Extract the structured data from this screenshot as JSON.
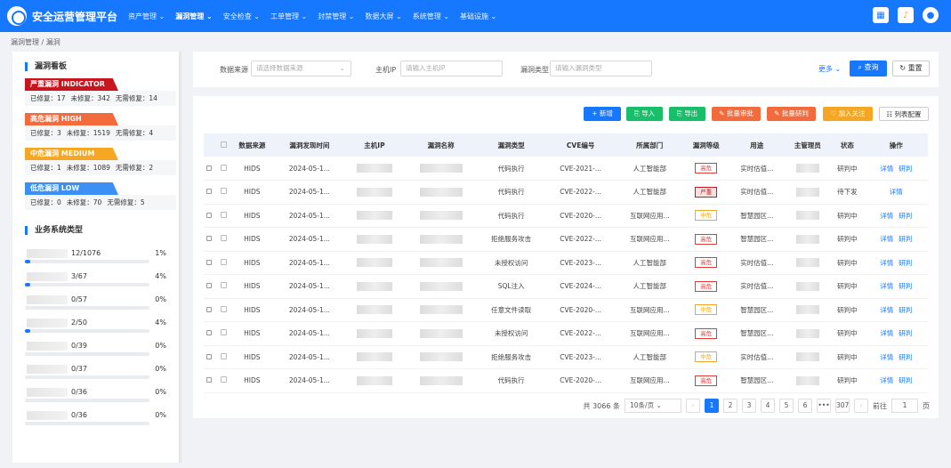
{
  "app": {
    "title": "安全运营管理平台"
  },
  "nav": [
    "资产管理",
    "漏洞管理",
    "安全检查",
    "工单管理",
    "封禁管理",
    "数据大屏",
    "系统管理",
    "基础设施"
  ],
  "breadcrumb": "漏洞管理 / 漏洞",
  "left": {
    "board_title": "漏洞看板",
    "levels": [
      {
        "label": "严重漏洞 INDICATOR",
        "color": "#c9151e",
        "fixed": "已修复：17",
        "unfixed": "未修复：342",
        "nofix": "无需修复：14"
      },
      {
        "label": "高危漏洞 HIGH",
        "color": "#f36b3c",
        "fixed": "已修复：3",
        "unfixed": "未修复：1519",
        "nofix": "无需修复：4"
      },
      {
        "label": "中危漏洞 MEDIUM",
        "color": "#f5a623",
        "fixed": "已修复：1",
        "unfixed": "未修复：1089",
        "nofix": "无需修复：2"
      },
      {
        "label": "低危漏洞 LOW",
        "color": "#3b8ff5",
        "fixed": "已修复：0",
        "unfixed": "未修复：70",
        "nofix": "无需修复：5"
      }
    ],
    "biz_title": "业务系统类型",
    "biz": [
      {
        "count": "12/1076",
        "pct": "1%",
        "fill": 0.01
      },
      {
        "count": "3/67",
        "pct": "4%",
        "fill": 0.04
      },
      {
        "count": "0/57",
        "pct": "0%",
        "fill": 0
      },
      {
        "count": "2/50",
        "pct": "4%",
        "fill": 0.04
      },
      {
        "count": "0/39",
        "pct": "0%",
        "fill": 0
      },
      {
        "count": "0/37",
        "pct": "0%",
        "fill": 0
      },
      {
        "count": "0/36",
        "pct": "0%",
        "fill": 0
      },
      {
        "count": "0/36",
        "pct": "0%",
        "fill": 0
      }
    ]
  },
  "filter": {
    "source_label": "数据来源",
    "source_ph": "请选择数据来源",
    "ip_label": "主机IP",
    "ip_ph": "请输入主机IP",
    "type_label": "漏洞类型",
    "type_ph": "请输入漏洞类型",
    "more": "更多",
    "query": "查询",
    "reset": "重置"
  },
  "actions": {
    "add": "新增",
    "import": "导入",
    "export": "导出",
    "batch_approve": "批量审批",
    "batch_judge": "批量研判",
    "follow": "加入关注",
    "columns": "列表配置"
  },
  "columns": [
    "数据来源",
    "漏洞发现时间",
    "主机IP",
    "漏洞名称",
    "漏洞类型",
    "CVE编号",
    "所属部门",
    "漏洞等级",
    "用途",
    "主管理员",
    "状态",
    "操作"
  ],
  "rows": [
    {
      "src": "HIDS",
      "time": "2024-05-1...",
      "type": "代码执行",
      "cve": "CVE-2021-...",
      "dept": "人工智能部",
      "level": "高危",
      "lc": "#e53935",
      "use": "实时估值...",
      "status": "研判中",
      "ops": [
        "详情",
        "研判"
      ]
    },
    {
      "src": "HIDS",
      "time": "2024-05-1...",
      "type": "代码执行",
      "cve": "CVE-2022-...",
      "dept": "人工智能部",
      "level": "严重",
      "lc": "#c9151e",
      "use": "实时估值...",
      "status": "待下发",
      "ops": [
        "详情"
      ]
    },
    {
      "src": "HIDS",
      "time": "2024-05-1...",
      "type": "代码执行",
      "cve": "CVE-2020-...",
      "dept": "互联网应用...",
      "level": "中危",
      "lc": "#f5a623",
      "use": "智慧园区...",
      "status": "研判中",
      "ops": [
        "详情",
        "研判"
      ]
    },
    {
      "src": "HIDS",
      "time": "2024-05-1...",
      "type": "拒绝服务攻击",
      "cve": "CVE-2022-...",
      "dept": "互联网应用...",
      "level": "高危",
      "lc": "#e53935",
      "use": "智慧园区...",
      "status": "研判中",
      "ops": [
        "详情",
        "研判"
      ]
    },
    {
      "src": "HIDS",
      "time": "2024-05-1...",
      "type": "未授权访问",
      "cve": "CVE-2023-...",
      "dept": "人工智能部",
      "level": "高危",
      "lc": "#e53935",
      "use": "实时估值...",
      "status": "研判中",
      "ops": [
        "详情",
        "研判"
      ]
    },
    {
      "src": "HIDS",
      "time": "2024-05-1...",
      "type": "SQL注入",
      "cve": "CVE-2024-...",
      "dept": "人工智能部",
      "level": "高危",
      "lc": "#e53935",
      "use": "实时估值...",
      "status": "研判中",
      "ops": [
        "详情",
        "研判"
      ]
    },
    {
      "src": "HIDS",
      "time": "2024-05-1...",
      "type": "任意文件读取",
      "cve": "CVE-2020-...",
      "dept": "互联网应用...",
      "level": "中危",
      "lc": "#f5a623",
      "use": "智慧园区...",
      "status": "研判中",
      "ops": [
        "详情",
        "研判"
      ]
    },
    {
      "src": "HIDS",
      "time": "2024-05-1...",
      "type": "未授权访问",
      "cve": "CVE-2022-...",
      "dept": "互联网应用...",
      "level": "高危",
      "lc": "#e53935",
      "use": "智慧园区...",
      "status": "研判中",
      "ops": [
        "详情",
        "研判"
      ]
    },
    {
      "src": "HIDS",
      "time": "2024-05-1...",
      "type": "拒绝服务攻击",
      "cve": "CVE-2023-...",
      "dept": "人工智能部",
      "level": "中危",
      "lc": "#f5a623",
      "use": "实时估值...",
      "status": "研判中",
      "ops": [
        "详情",
        "研判"
      ]
    },
    {
      "src": "HIDS",
      "time": "2024-05-1...",
      "type": "代码执行",
      "cve": "CVE-2020-...",
      "dept": "互联网应用...",
      "level": "高危",
      "lc": "#e53935",
      "use": "智慧园区...",
      "status": "研判中",
      "ops": [
        "详情",
        "研判"
      ]
    }
  ],
  "pager": {
    "total": "共 3066 条",
    "size": "10条/页",
    "pages": [
      "1",
      "2",
      "3",
      "4",
      "5",
      "6",
      "•••",
      "307"
    ],
    "goto": "前往",
    "page": "1",
    "unit": "页"
  }
}
